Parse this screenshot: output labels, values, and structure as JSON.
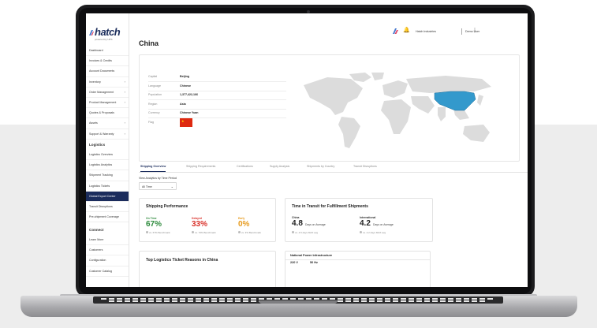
{
  "app": {
    "logo_text": "hatch",
    "logo_tagline": "powered by UPS"
  },
  "header": {
    "company": "Hatch Industries",
    "user": "Demo User"
  },
  "sidebar": {
    "main_items": [
      {
        "label": "Dashboard",
        "chevron": false
      },
      {
        "label": "Invoices & Credits",
        "chevron": false
      },
      {
        "label": "Account Documents",
        "chevron": false
      },
      {
        "label": "Inventory",
        "chevron": true
      },
      {
        "label": "Order Management",
        "chevron": true
      },
      {
        "label": "Product Management",
        "chevron": true
      },
      {
        "label": "Quotes & Proposals",
        "chevron": false
      },
      {
        "label": "Assets",
        "chevron": true
      },
      {
        "label": "Support & Warranty",
        "chevron": true
      }
    ],
    "logistics_heading": "Logistics",
    "logistics_items": [
      {
        "label": "Logistics Overview"
      },
      {
        "label": "Logistics Analytics"
      },
      {
        "label": "Shipment Tracking"
      },
      {
        "label": "Logistics Tickets"
      },
      {
        "label": "Global Export Center",
        "active": true
      },
      {
        "label": "Transit Disruptions"
      },
      {
        "label": "Pre-shipment Coverage"
      }
    ],
    "connect_heading": "Connect",
    "connect_items": [
      {
        "label": "Learn More"
      },
      {
        "label": "Customers"
      },
      {
        "label": "Configuration"
      },
      {
        "label": "Customer Catalog"
      }
    ]
  },
  "page": {
    "title": "China"
  },
  "country_info": [
    {
      "label": "Capital",
      "value": "Beijing"
    },
    {
      "label": "Language",
      "value": "Chinese"
    },
    {
      "label": "Population",
      "value": "1,377,422,166"
    },
    {
      "label": "Region",
      "value": "Asia"
    },
    {
      "label": "Currency",
      "value": "Chinese Yuan"
    },
    {
      "label": "Flag",
      "value": ""
    }
  ],
  "colors": {
    "brand_navy": "#1b2c5c",
    "map_land": "#dcdcdc",
    "map_highlight": "#3399cc",
    "flag_red": "#de2910",
    "on_time": "#2e8b3d",
    "delayed": "#d9322b",
    "early": "#e69a1c"
  },
  "tabs": [
    {
      "label": "Shipping Overview",
      "active": true
    },
    {
      "label": "Shipping Requirements"
    },
    {
      "label": "Certifications"
    },
    {
      "label": "Supply Analysis"
    },
    {
      "label": "Shipments by Country"
    },
    {
      "label": "Transit Disruptions"
    }
  ],
  "analytics": {
    "label": "View Analytics by Time Period",
    "selected": "All Time"
  },
  "shipping_performance": {
    "title": "Shipping Performance",
    "metrics": [
      {
        "label": "On Time",
        "value": "67%",
        "sub": "vs. 67% Benchmark"
      },
      {
        "label": "Delayed",
        "value": "33%",
        "sub": "vs. 70% Benchmark"
      },
      {
        "label": "Early",
        "value": "0%",
        "sub": "vs. 3% Benchmark"
      }
    ]
  },
  "transit_time": {
    "title": "Time in Transit for Fulfillment Shipments",
    "items": [
      {
        "label": "China",
        "value": "4.8",
        "unit": "Days on Average",
        "sub": "vs. 4.5 days MAX avg"
      },
      {
        "label": "International",
        "value": "4.2",
        "unit": "Days on Average",
        "sub": "vs. 4.2 days MAX avg"
      }
    ]
  },
  "tickets": {
    "title": "Top Logistics Ticket Reasons in China"
  },
  "power": {
    "title": "National Power Infrastructure",
    "voltage": "220 V",
    "frequency": "50 Hz"
  }
}
